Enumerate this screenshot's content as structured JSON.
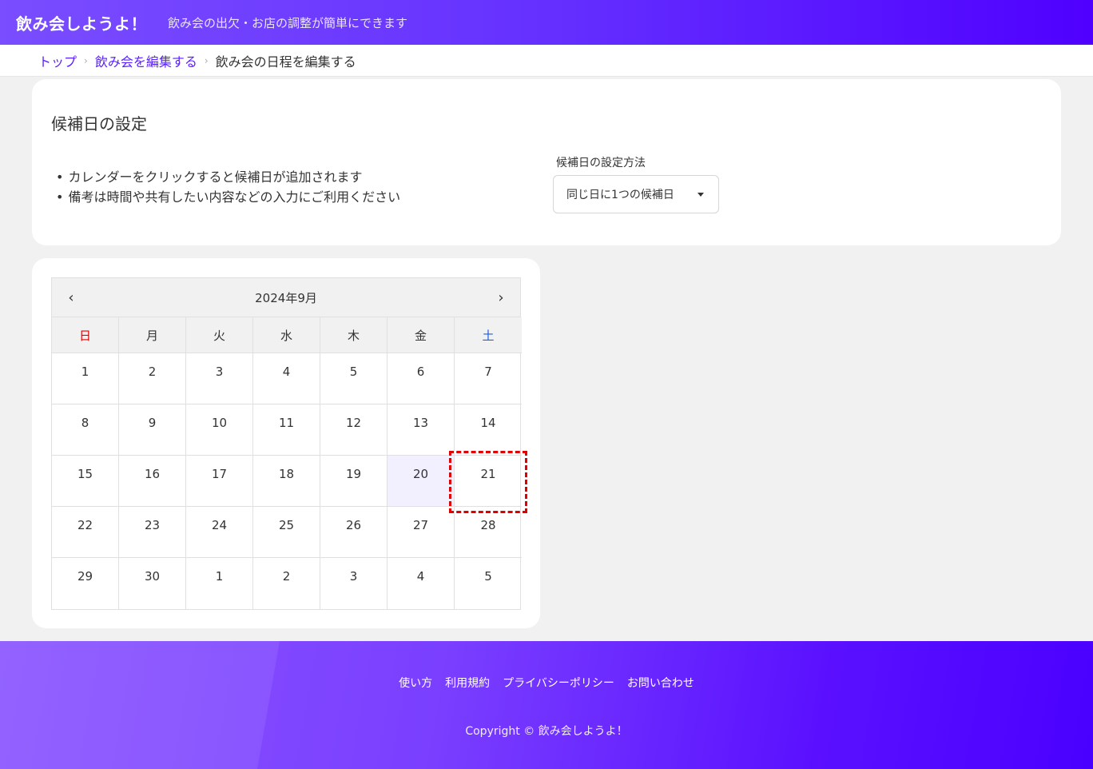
{
  "header": {
    "title": "飲み会しようよ！",
    "subtitle": "飲み会の出欠・お店の調整が簡単にできます"
  },
  "breadcrumb": {
    "items": [
      "トップ",
      "飲み会を編集する"
    ],
    "current": "飲み会の日程を編集する"
  },
  "settings": {
    "title": "候補日の設定",
    "bullets": [
      "カレンダーをクリックすると候補日が追加されます",
      "備考は時間や共有したい内容などの入力にご利用ください"
    ],
    "method_label": "候補日の設定方法",
    "method_value": "同じ日に1つの候補日"
  },
  "calendar": {
    "month_label": "2024年9月",
    "prev_icon": "chevron-left-icon",
    "next_icon": "chevron-right-icon",
    "weekdays": [
      "日",
      "月",
      "火",
      "水",
      "木",
      "金",
      "土"
    ],
    "weeks": [
      [
        "1",
        "2",
        "3",
        "4",
        "5",
        "6",
        "7"
      ],
      [
        "8",
        "9",
        "10",
        "11",
        "12",
        "13",
        "14"
      ],
      [
        "15",
        "16",
        "17",
        "18",
        "19",
        "20",
        "21"
      ],
      [
        "22",
        "23",
        "24",
        "25",
        "26",
        "27",
        "28"
      ],
      [
        "29",
        "30",
        "1",
        "2",
        "3",
        "4",
        "5"
      ]
    ],
    "today": "20",
    "sunday_color": "#e00000",
    "saturday_color": "#1f5fe0",
    "highlight_color": "#f2efff"
  },
  "footer": {
    "links": [
      "使い方",
      "利用規約",
      "プライバシーポリシー",
      "お問い合わせ"
    ],
    "copyright": "Copyright © 飲み会しようよ！"
  }
}
